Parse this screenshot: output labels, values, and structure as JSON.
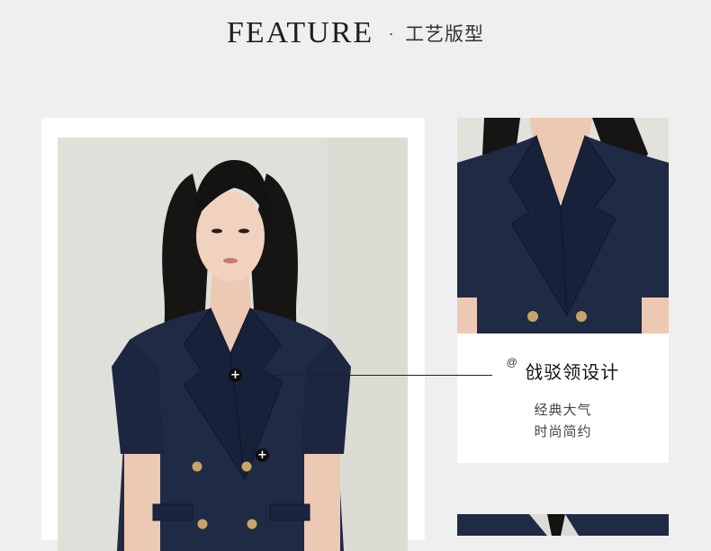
{
  "header": {
    "title_en": "FEATURE",
    "separator": "·",
    "title_cn": "工艺版型"
  },
  "callout": {
    "at_mark": "@",
    "title": "戗驳领设计",
    "desc_line1": "经典大气",
    "desc_line2": "时尚简约",
    "hotspot_symbol": "+"
  },
  "colors": {
    "background": "#efefef",
    "card": "#ffffff",
    "garment_navy": "#1f2a44",
    "button_gold": "#c9a46a",
    "hotspot": "#0d0d0d"
  },
  "icons": {
    "hotspot": "plus-circle-icon",
    "annotation": "at-mark-icon"
  }
}
